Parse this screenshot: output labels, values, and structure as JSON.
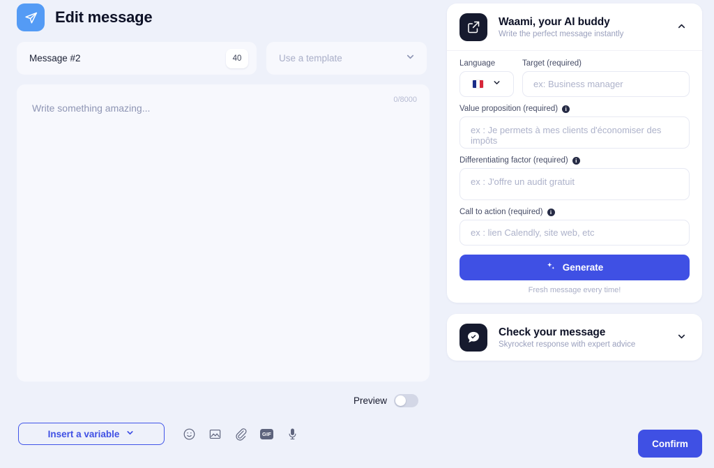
{
  "header": {
    "icon": "send-plane-icon",
    "title": "Edit message",
    "icon_bg": "#549bf5"
  },
  "message_name": {
    "value": "Message #2",
    "char_count": "40"
  },
  "template_select": {
    "placeholder": "Use a template",
    "chevron": "chevron-down-icon"
  },
  "editor": {
    "placeholder": "Write something amazing...",
    "counter": "0/8000"
  },
  "preview": {
    "label": "Preview",
    "state": "off"
  },
  "bottom_bar": {
    "insert_variable_label": "Insert a variable",
    "tools": [
      {
        "name": "emoji-icon",
        "label": ""
      },
      {
        "name": "image-icon",
        "label": ""
      },
      {
        "name": "attachment-icon",
        "label": ""
      },
      {
        "name": "gif-icon",
        "label": "GIF"
      },
      {
        "name": "microphone-icon",
        "label": ""
      }
    ]
  },
  "confirm_button": {
    "label": "Confirm"
  },
  "waami_panel": {
    "avatar_icon": "edit-square-icon",
    "title": "Waami, your AI buddy",
    "subtitle": "Write the perfect message instantly",
    "chevron": "chevron-up-icon",
    "language": {
      "label": "Language",
      "selected_flag": "flag-france",
      "flag_colors": [
        "#1b2d88",
        "#ffffff",
        "#d7273a"
      ]
    },
    "target": {
      "label": "Target (required)",
      "placeholder": "ex: Business manager"
    },
    "value_proposition": {
      "label": "Value proposition (required)",
      "info": "i",
      "placeholder": "ex : Je permets à mes clients d'économiser des impôts"
    },
    "differentiating_factor": {
      "label": "Differentiating factor (required)",
      "info": "i",
      "placeholder": "ex : J'offre un audit gratuit"
    },
    "call_to_action": {
      "label": "Call to action (required)",
      "info": "i",
      "placeholder": "ex : lien Calendly, site web, etc"
    },
    "generate": {
      "label": "Generate",
      "icon": "sparkle-icon",
      "note": "Fresh message every time!",
      "color": "#3f50e4"
    }
  },
  "check_panel": {
    "avatar_icon": "chat-check-icon",
    "title": "Check your message",
    "subtitle": "Skyrocket response with expert advice",
    "chevron": "chevron-down-icon"
  }
}
